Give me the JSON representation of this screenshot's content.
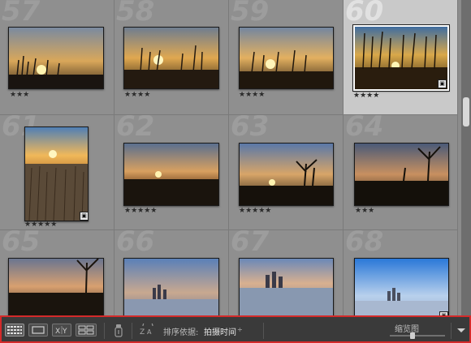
{
  "grid": {
    "cells": [
      {
        "number": "57",
        "stars": "★★★",
        "selected": false
      },
      {
        "number": "58",
        "stars": "★★★★",
        "selected": false
      },
      {
        "number": "59",
        "stars": "★★★★",
        "selected": false
      },
      {
        "number": "60",
        "stars": "★★★★",
        "selected": true
      },
      {
        "number": "61",
        "stars": "★★★★★",
        "selected": false
      },
      {
        "number": "62",
        "stars": "★★★★★",
        "selected": false
      },
      {
        "number": "63",
        "stars": "★★★★★",
        "selected": false
      },
      {
        "number": "64",
        "stars": "★★★",
        "selected": false
      },
      {
        "number": "65",
        "stars": "",
        "selected": false
      },
      {
        "number": "66",
        "stars": "",
        "selected": false
      },
      {
        "number": "67",
        "stars": "",
        "selected": false
      },
      {
        "number": "68",
        "stars": "",
        "selected": false
      }
    ]
  },
  "toolbar": {
    "sort_label": "排序依据:",
    "sort_value": "拍摄时间",
    "sort_chevron": "÷",
    "thumbnail_label": "缩览图",
    "thumbnail_level": 0.4,
    "icons": [
      "grid-view-icon",
      "loupe-view-icon",
      "compare-view-icon",
      "survey-view-icon",
      "painter-icon",
      "sort-direction-icon",
      "toolbar-menu-icon"
    ]
  },
  "colors": {
    "highlight": "#d42a2a",
    "selected_cell": "#c9c9c9"
  }
}
